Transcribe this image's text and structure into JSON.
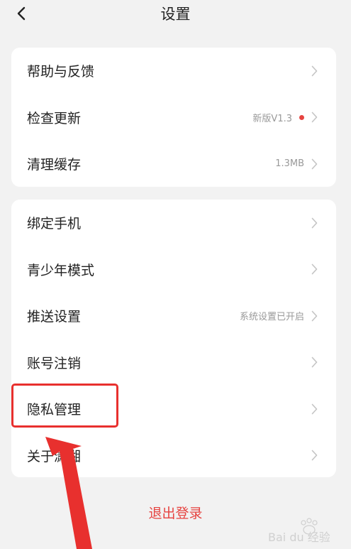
{
  "header": {
    "title": "设置",
    "back_icon": "chevron-left-icon"
  },
  "group1": {
    "items": [
      {
        "label": "帮助与反馈",
        "value": ""
      },
      {
        "label": "检查更新",
        "value": "新版V1.3",
        "badge_color": "#e64340"
      },
      {
        "label": "清理缓存",
        "value": "1.3MB"
      }
    ]
  },
  "group2": {
    "items": [
      {
        "label": "绑定手机",
        "value": ""
      },
      {
        "label": "青少年模式",
        "value": ""
      },
      {
        "label": "推送设置",
        "value": "系统设置已开启"
      },
      {
        "label": "账号注销",
        "value": ""
      },
      {
        "label": "隐私管理",
        "value": ""
      },
      {
        "label": "关于潇湘",
        "value": ""
      }
    ]
  },
  "footer": {
    "logout_label": "退出登录"
  },
  "colors": {
    "accent_red": "#e64340",
    "annotation_red": "#e8302e",
    "background": "#f2f2f2"
  },
  "watermark_text": "Bai du 经验"
}
